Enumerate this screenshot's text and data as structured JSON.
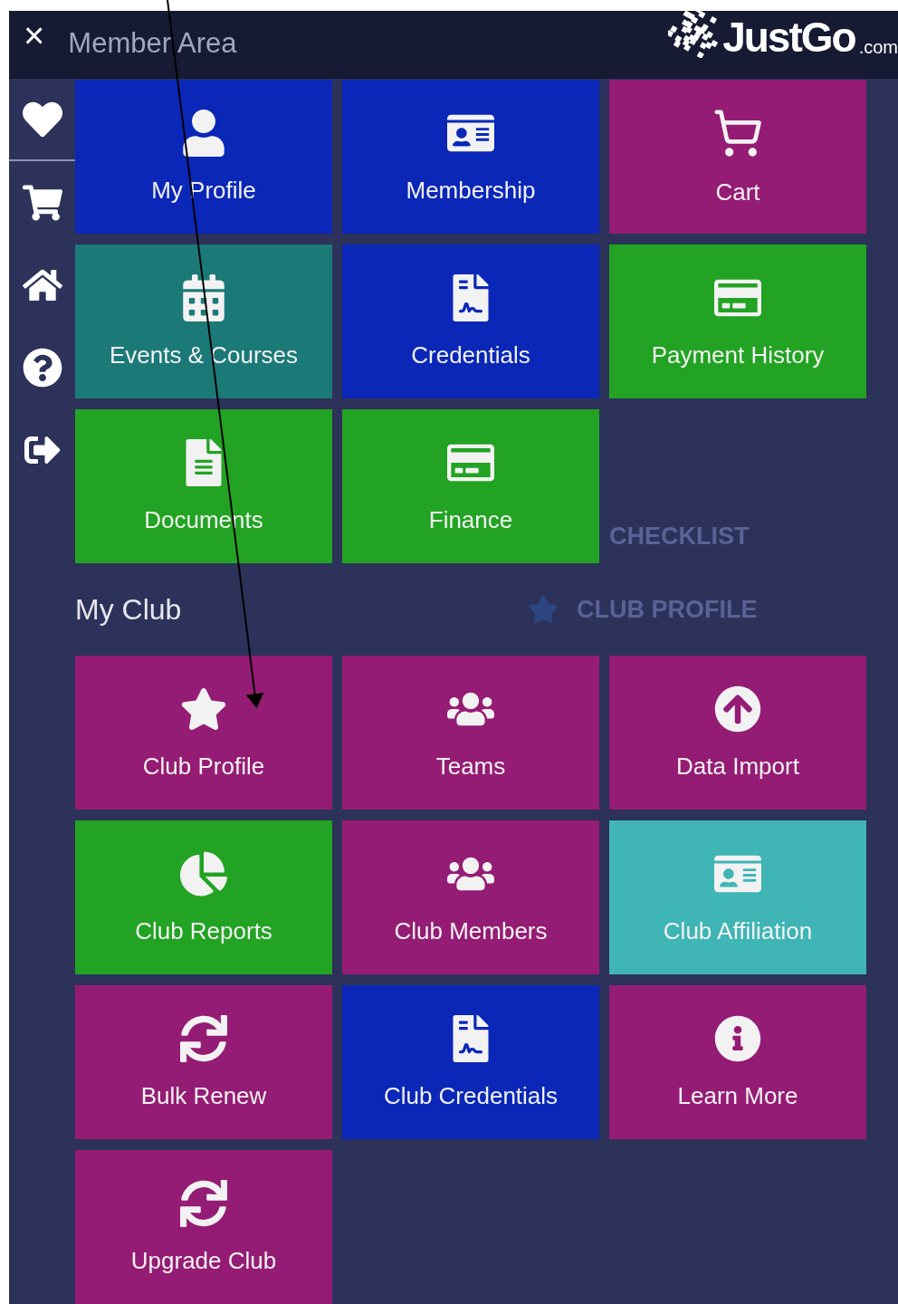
{
  "header": {
    "close": "×",
    "title": "Member Area",
    "logo": {
      "name": "JustGo",
      "suffix": ".com"
    }
  },
  "sidebar": {
    "items": [
      {
        "divider": true
      },
      {
        "divider": false
      },
      {
        "divider": false
      },
      {
        "divider": false
      },
      {
        "divider": false
      }
    ]
  },
  "member_tiles": [
    {
      "label": "My Profile",
      "color": "#0a27b8"
    },
    {
      "label": "Membership",
      "color": "#0a27b8"
    },
    {
      "label": "Cart",
      "color": "#951c74"
    },
    {
      "label": "Events & Courses",
      "color": "#1b7a78"
    },
    {
      "label": "Credentials",
      "color": "#0a27b8"
    },
    {
      "label": "Payment History",
      "color": "#22a323"
    },
    {
      "label": "Documents",
      "color": "#22a323"
    },
    {
      "label": "Finance",
      "color": "#22a323"
    }
  ],
  "background_page": {
    "section": "CHECKLIST",
    "item": "CLUB PROFILE"
  },
  "club_section": {
    "title": "My Club",
    "tiles": [
      {
        "label": "Club Profile",
        "color": "#951c74"
      },
      {
        "label": "Teams",
        "color": "#951c74"
      },
      {
        "label": "Data Import",
        "color": "#951c74"
      },
      {
        "label": "Club Reports",
        "color": "#22a323"
      },
      {
        "label": "Club Members",
        "color": "#951c74"
      },
      {
        "label": "Club Affiliation",
        "color": "#3fb5b5"
      },
      {
        "label": "Bulk Renew",
        "color": "#951c74"
      },
      {
        "label": "Club Credentials",
        "color": "#0a27b8"
      },
      {
        "label": "Learn More",
        "color": "#951c74"
      },
      {
        "label": "Upgrade Club",
        "color": "#951c74"
      }
    ]
  }
}
